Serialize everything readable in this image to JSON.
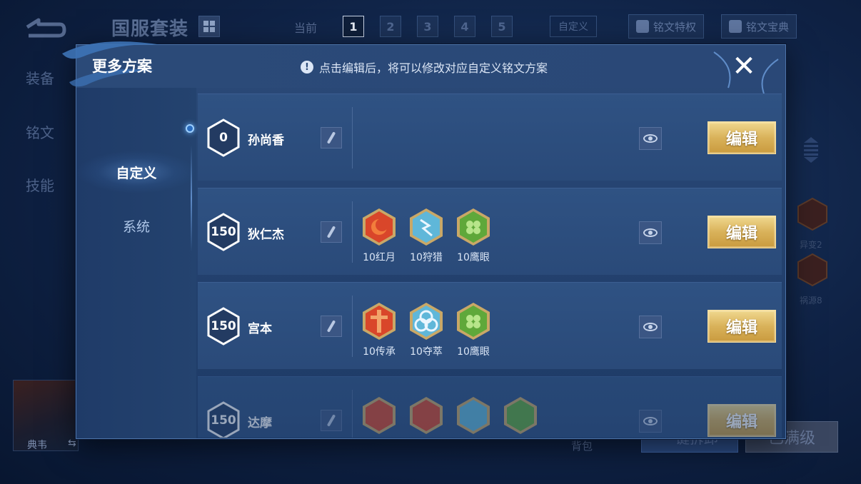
{
  "background": {
    "title": "国服套装",
    "current_label": "当前",
    "pages": [
      "1",
      "2",
      "3",
      "4",
      "5"
    ],
    "active_page": "1",
    "custom_label": "自定义",
    "privilege_label": "铭文特权",
    "handbook_label": "铭文宝典",
    "left_tabs": [
      "装备",
      "铭文",
      "技能"
    ],
    "right_runes": [
      {
        "label": "异变2"
      },
      {
        "label": "祸源8"
      }
    ],
    "hero_name": "典韦",
    "bag_label": "背包",
    "blue_button": "一键拆卸",
    "gray_button": "已满级"
  },
  "modal": {
    "title": "更多方案",
    "hint": "点击编辑后，将可以修改对应自定义铭文方案",
    "hint_icon": "info-icon",
    "close_icon": "close-icon",
    "tabs": [
      {
        "label": "自定义",
        "active": true
      },
      {
        "label": "系统",
        "active": false
      }
    ],
    "edit_label": "编辑",
    "rows": [
      {
        "level": "0",
        "hero": "孙尚香",
        "runes": []
      },
      {
        "level": "150",
        "hero": "狄仁杰",
        "runes": [
          {
            "label": "10红月",
            "color": "#d9462a",
            "icon": "red-moon-rune-icon"
          },
          {
            "label": "10狩猎",
            "color": "#5fb7d9",
            "icon": "hunt-rune-icon"
          },
          {
            "label": "10鹰眼",
            "color": "#5fa83a",
            "icon": "hawkeye-rune-icon"
          }
        ]
      },
      {
        "level": "150",
        "hero": "宫本",
        "runes": [
          {
            "label": "10传承",
            "color": "#d9462a",
            "icon": "inheritance-rune-icon"
          },
          {
            "label": "10夺萃",
            "color": "#5fb7d9",
            "icon": "plunder-rune-icon"
          },
          {
            "label": "10鹰眼",
            "color": "#5fa83a",
            "icon": "hawkeye-rune-icon"
          }
        ]
      },
      {
        "level": "150",
        "hero": "达摩",
        "runes": [
          {
            "label": "",
            "color": "#d9462a",
            "icon": "red-rune-icon"
          },
          {
            "label": "",
            "color": "#d9462a",
            "icon": "red-rune-icon"
          },
          {
            "label": "",
            "color": "#5fb7d9",
            "icon": "blue-rune-icon"
          },
          {
            "label": "",
            "color": "#5fa83a",
            "icon": "green-rune-icon"
          }
        ]
      }
    ]
  },
  "colors": {
    "accent_gold": "#d9b25a",
    "modal_bg": "#2b4a78",
    "text_light": "#dbe6f6"
  }
}
